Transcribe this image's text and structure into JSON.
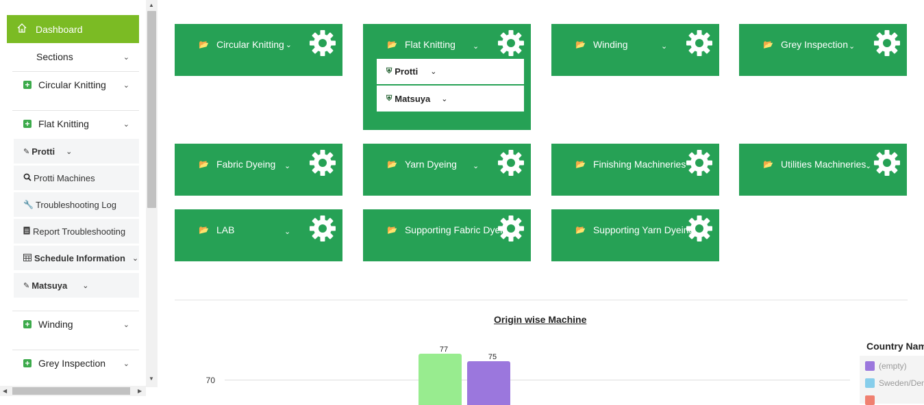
{
  "sidebar": {
    "dashboard_label": "Dashboard",
    "sections_label": "Sections",
    "items": [
      {
        "label": "Circular Knitting"
      },
      {
        "label": "Flat Knitting"
      },
      {
        "label": "Winding"
      },
      {
        "label": "Grey Inspection"
      }
    ],
    "flat_sub": [
      {
        "label": "Protti",
        "bold": true
      },
      {
        "label": "Protti Machines"
      },
      {
        "label": "Troubleshooting Log"
      },
      {
        "label": "Report Troubleshooting"
      },
      {
        "label": "Schedule Information",
        "bold": true
      },
      {
        "label": "Matsuya",
        "bold": true
      }
    ]
  },
  "tiles": [
    {
      "label": "Circular Knitting"
    },
    {
      "label": "Flat Knitting",
      "dropdown": [
        "Protti",
        "Matsuya"
      ]
    },
    {
      "label": "Winding"
    },
    {
      "label": "Grey Inspection"
    },
    {
      "label": "Fabric Dyeing"
    },
    {
      "label": "Yarn Dyeing"
    },
    {
      "label": "Finishing Machineries"
    },
    {
      "label": "Utilities Machineries"
    },
    {
      "label": "LAB"
    },
    {
      "label": "Supporting Fabric Dyeing"
    },
    {
      "label": "Supporting Yarn Dyeing"
    }
  ],
  "colors": {
    "tile": "#26a155",
    "accent": "#7bbb24"
  },
  "chart_data": {
    "type": "bar",
    "title": "Origin wise Machine",
    "y_tick_visible": 70,
    "bars": [
      {
        "value": 77,
        "color": "#98ec8f"
      },
      {
        "value": 75,
        "color": "#9b77dd"
      }
    ],
    "legend": {
      "title": "Country Name",
      "entries": [
        {
          "name": "(empty)",
          "color": "#9b77dd"
        },
        {
          "name": "Sweden/Den",
          "color": "#87ceeb"
        }
      ],
      "placement": "right"
    }
  }
}
